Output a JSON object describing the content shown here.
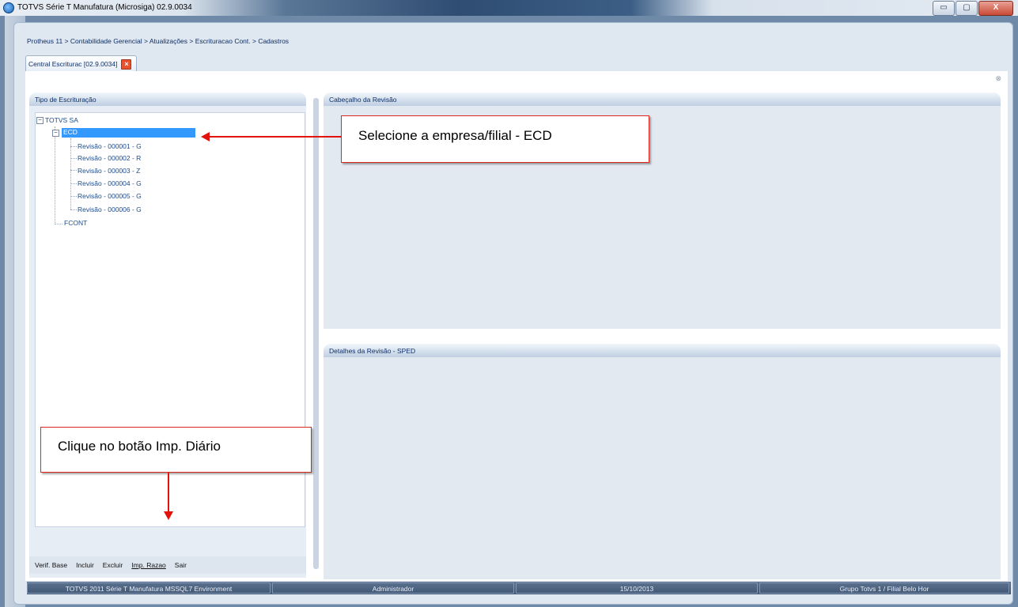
{
  "window": {
    "title": "TOTVS Série T Manufatura (Microsiga) 02.9.0034",
    "min_label": "▭",
    "max_label": "▢",
    "close_label": "X"
  },
  "breadcrumb": "Protheus 11 > Contabilidade Gerencial > Atualizações > Escrituracao Cont. > Cadastros",
  "tab": {
    "label": "Central Escriturac [02.9.0034]",
    "close_label": "×"
  },
  "content_close": "⊗",
  "left_panel": {
    "title": "Tipo de Escrituração",
    "tree": {
      "root": "TOTVS SA",
      "ecd": "ECD",
      "revisions": [
        "Revisão - 000001 - G",
        "Revisão - 000002 - R",
        "Revisão - 000003 - Z",
        "Revisão - 000004 - G",
        "Revisão - 000005 - G",
        "Revisão - 000006 - G"
      ],
      "fcont": "FCONT"
    },
    "buttons": {
      "verif_base": "Verif. Base",
      "incluir": "Incluir",
      "excluir": "Excluir",
      "imp_razao": "Imp. Razao",
      "sair": "Sair"
    }
  },
  "right_top": {
    "title": "Cabeçalho da Revisão"
  },
  "right_bottom": {
    "title": "Detalhes da Revisão - SPED"
  },
  "callouts": {
    "select": "Selecione a empresa/filial  -   ECD",
    "click": "Clique no botão Imp. Diário"
  },
  "status": {
    "environment": "TOTVS 2011 Série T Manufatura MSSQL7 Environment",
    "user": "Administrador",
    "date": "15/10/2013",
    "branch": "Grupo Totvs 1 / Filial Belo Hor"
  },
  "colors": {
    "accent": "#3399ff",
    "callout_border": "#d9281f",
    "arrow": "#e3120b"
  }
}
